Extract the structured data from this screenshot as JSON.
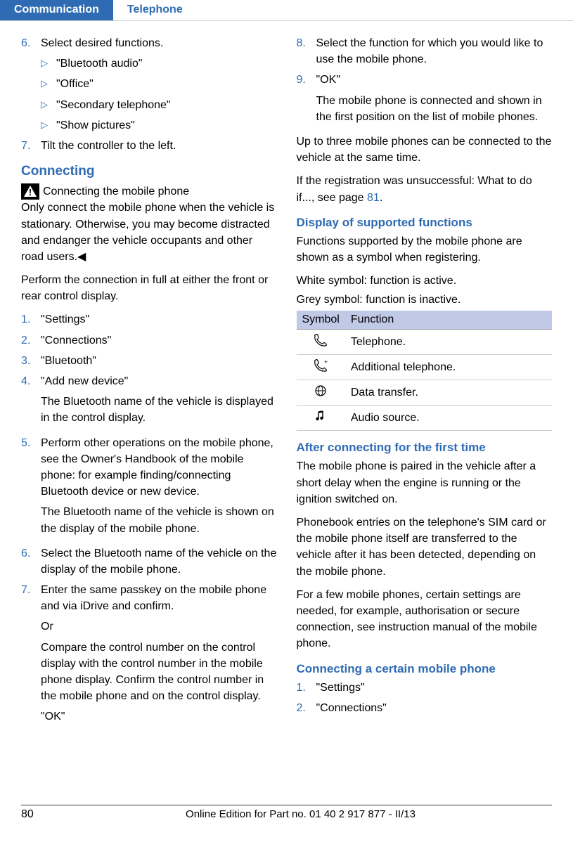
{
  "header": {
    "tab_active": "Communication",
    "tab_inactive": "Telephone"
  },
  "left": {
    "step6": {
      "num": "6.",
      "text": "Select desired functions."
    },
    "step6_items": [
      "\"Bluetooth audio\"",
      "\"Office\"",
      "\"Secondary telephone\"",
      "\"Show pictures\""
    ],
    "step7": {
      "num": "7.",
      "text": "Tilt the controller to the left."
    },
    "connecting_h": "Connecting",
    "warn_title": "Connecting the mobile phone",
    "warn_body": "Only connect the mobile phone when the vehicle is stationary. Otherwise, you may become distracted and endanger the vehicle occupants and other road users.◀",
    "intro": "Perform the connection in full at either the front or rear control display.",
    "s1": {
      "num": "1.",
      "text": "\"Settings\""
    },
    "s2": {
      "num": "2.",
      "text": "\"Connections\""
    },
    "s3": {
      "num": "3.",
      "text": "\"Bluetooth\""
    },
    "s4": {
      "num": "4.",
      "text": "\"Add new device\"",
      "p": "The Bluetooth name of the vehicle is displayed in the control display."
    },
    "s5": {
      "num": "5.",
      "text": "Perform other operations on the mobile phone, see the Owner's Handbook of the mobile phone: for example finding/connecting Bluetooth device or new device.",
      "p": "The Bluetooth name of the vehicle is shown on the display of the mobile phone."
    },
    "s6": {
      "num": "6.",
      "text": "Select the Bluetooth name of the vehicle on the display of the mobile phone."
    },
    "s7": {
      "num": "7.",
      "p1": "Enter the same passkey on the mobile phone and via iDrive and confirm.",
      "p2": "Or",
      "p3": "Compare the control number on the control display with the control number in the mobile phone display. Confirm the control number in the mobile phone and on the control display.",
      "p4": "\"OK\""
    }
  },
  "right": {
    "s8": {
      "num": "8.",
      "text": "Select the function for which you would like to use the mobile phone."
    },
    "s9": {
      "num": "9.",
      "text": "\"OK\"",
      "p": "The mobile phone is connected and shown in the first position on the list of mobile phones."
    },
    "p_upto": "Up to three mobile phones can be connected to the vehicle at the same time.",
    "p_unsucc_pre": "If the registration was unsuccessful: What to do if..., see page ",
    "p_unsucc_link": "81",
    "p_unsucc_post": ".",
    "h_display": "Display of supported functions",
    "p_disp1": "Functions supported by the mobile phone are shown as a symbol when registering.",
    "p_disp2": "White symbol: function is active.",
    "p_disp3": "Grey symbol: function is inactive.",
    "tbl": {
      "h1": "Symbol",
      "h2": "Function",
      "r1": "Telephone.",
      "r2": "Additional telephone.",
      "r3": "Data transfer.",
      "r4": "Audio source."
    },
    "h_after": "After connecting for the first time",
    "p_after1": "The mobile phone is paired in the vehicle after a short delay when the engine is running or the ignition switched on.",
    "p_after2": "Phonebook entries on the telephone's SIM card or the mobile phone itself are transferred to the vehicle after it has been detected, depending on the mobile phone.",
    "p_after3": "For a few mobile phones, certain settings are needed, for example, authorisation or secure connection, see instruction manual of the mobile phone.",
    "h_certain": "Connecting a certain mobile phone",
    "c1": {
      "num": "1.",
      "text": "\"Settings\""
    },
    "c2": {
      "num": "2.",
      "text": "\"Connections\""
    }
  },
  "footer": {
    "page": "80",
    "text": "Online Edition for Part no. 01 40 2 917 877 - II/13"
  }
}
